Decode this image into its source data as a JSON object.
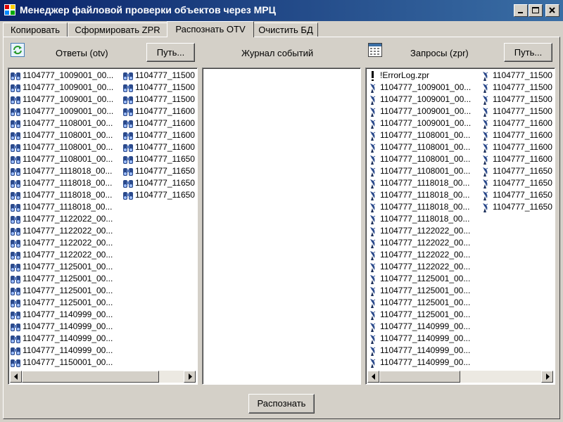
{
  "window": {
    "title": "Менеджер файловой проверки объектов через МРЦ"
  },
  "tabs": [
    {
      "label": "Копировать"
    },
    {
      "label": "Сформировать ZPR"
    },
    {
      "label": "Распознать OTV"
    },
    {
      "label": "Очистить БД"
    }
  ],
  "otv": {
    "label": "Ответы (otv)",
    "path_button": "Путь...",
    "refresh_icon": "refresh-icon",
    "col1": [
      "1104777_1009001_00...",
      "1104777_1009001_00...",
      "1104777_1009001_00...",
      "1104777_1009001_00...",
      "1104777_1108001_00...",
      "1104777_1108001_00...",
      "1104777_1108001_00...",
      "1104777_1108001_00...",
      "1104777_1118018_00...",
      "1104777_1118018_00...",
      "1104777_1118018_00...",
      "1104777_1118018_00...",
      "1104777_1122022_00...",
      "1104777_1122022_00...",
      "1104777_1122022_00...",
      "1104777_1122022_00...",
      "1104777_1125001_00...",
      "1104777_1125001_00...",
      "1104777_1125001_00...",
      "1104777_1125001_00...",
      "1104777_1140999_00...",
      "1104777_1140999_00...",
      "1104777_1140999_00...",
      "1104777_1140999_00...",
      "1104777_1150001_00..."
    ],
    "col2": [
      "1104777_11500",
      "1104777_11500",
      "1104777_11500",
      "1104777_11600",
      "1104777_11600",
      "1104777_11600",
      "1104777_11600",
      "1104777_11650",
      "1104777_11650",
      "1104777_11650",
      "1104777_11650"
    ]
  },
  "journal": {
    "label": "Журнал событий"
  },
  "zpr": {
    "label": "Запросы (zpr)",
    "path_button": "Путь...",
    "calendar_icon": "calendar-icon",
    "col1": [
      "!ErrorLog.zpr",
      "1104777_1009001_00...",
      "1104777_1009001_00...",
      "1104777_1009001_00...",
      "1104777_1009001_00...",
      "1104777_1108001_00...",
      "1104777_1108001_00...",
      "1104777_1108001_00...",
      "1104777_1108001_00...",
      "1104777_1118018_00...",
      "1104777_1118018_00...",
      "1104777_1118018_00...",
      "1104777_1118018_00...",
      "1104777_1122022_00...",
      "1104777_1122022_00...",
      "1104777_1122022_00...",
      "1104777_1122022_00...",
      "1104777_1125001_00...",
      "1104777_1125001_00...",
      "1104777_1125001_00...",
      "1104777_1125001_00...",
      "1104777_1140999_00...",
      "1104777_1140999_00...",
      "1104777_1140999_00...",
      "1104777_1140999_00..."
    ],
    "col2": [
      "1104777_11500",
      "1104777_11500",
      "1104777_11500",
      "1104777_11500",
      "1104777_11600",
      "1104777_11600",
      "1104777_11600",
      "1104777_11600",
      "1104777_11650",
      "1104777_11650",
      "1104777_11650",
      "1104777_11650"
    ]
  },
  "recognize_button": "Распознать"
}
